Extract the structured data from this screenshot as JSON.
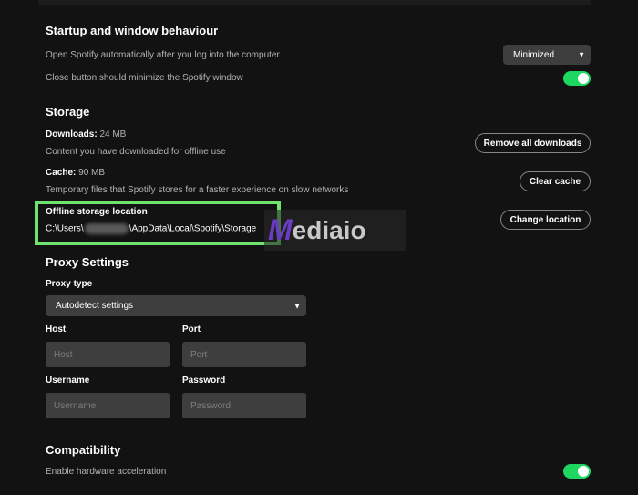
{
  "startup": {
    "title": "Startup and window behaviour",
    "open_auto_label": "Open Spotify automatically after you log into the computer",
    "open_auto_value": "Minimized",
    "close_minimize_label": "Close button should minimize the Spotify window"
  },
  "storage": {
    "title": "Storage",
    "downloads_label": "Downloads:",
    "downloads_value": "24 MB",
    "downloads_desc": "Content you have downloaded for offline use",
    "remove_downloads_button": "Remove all downloads",
    "cache_label": "Cache:",
    "cache_value": "90 MB",
    "cache_desc": "Temporary files that Spotify stores for a faster experience on slow networks",
    "clear_cache_button": "Clear cache",
    "offline_location_label": "Offline storage location",
    "offline_path_prefix": "C:\\Users\\",
    "offline_path_suffix": "\\AppData\\Local\\Spotify\\Storage",
    "change_location_button": "Change location"
  },
  "proxy": {
    "title": "Proxy Settings",
    "type_label": "Proxy type",
    "type_value": "Autodetect settings",
    "host_label": "Host",
    "host_placeholder": "Host",
    "port_label": "Port",
    "port_placeholder": "Port",
    "username_label": "Username",
    "username_placeholder": "Username",
    "password_label": "Password",
    "password_placeholder": "Password"
  },
  "compatibility": {
    "title": "Compatibility",
    "hw_accel_label": "Enable hardware acceleration"
  },
  "watermark": {
    "letter": "M",
    "text": "ediaio"
  },
  "colors": {
    "background": "#121212",
    "accent_green": "#1ed760",
    "highlight_box": "#6ee36e"
  }
}
